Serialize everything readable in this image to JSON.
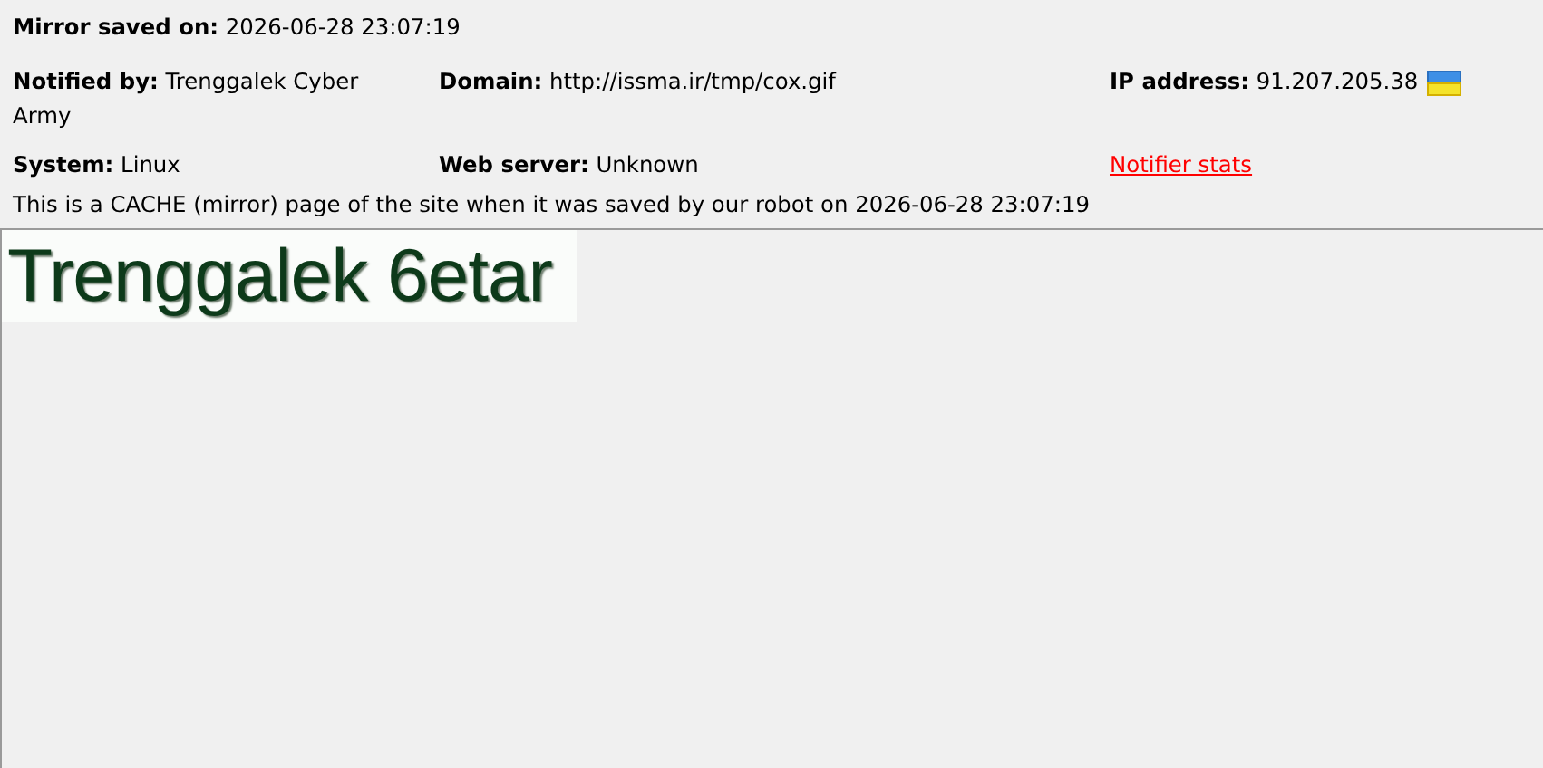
{
  "mirror_saved_on": {
    "label": "Mirror saved on:",
    "value": "2026-06-28 23:07:19"
  },
  "info_rows": [
    [
      {
        "label": "Notified by:",
        "value": "Trenggalek Cyber Army"
      },
      {
        "label": "Domain:",
        "value": "http://issma.ir/tmp/cox.gif"
      },
      {
        "label": "IP address:",
        "value": "91.207.205.38",
        "flag": true
      }
    ],
    [
      {
        "label": "System:",
        "value": "Linux"
      },
      {
        "label": "Web server:",
        "value": "Unknown"
      },
      {
        "link": "Notifier stats"
      }
    ]
  ],
  "notice": "This is a CACHE (mirror) page of the site when it was saved by our robot on 2026-06-28 23:07:19",
  "mirror_frame": {
    "banner_text": "Trenggalek 6etar"
  }
}
